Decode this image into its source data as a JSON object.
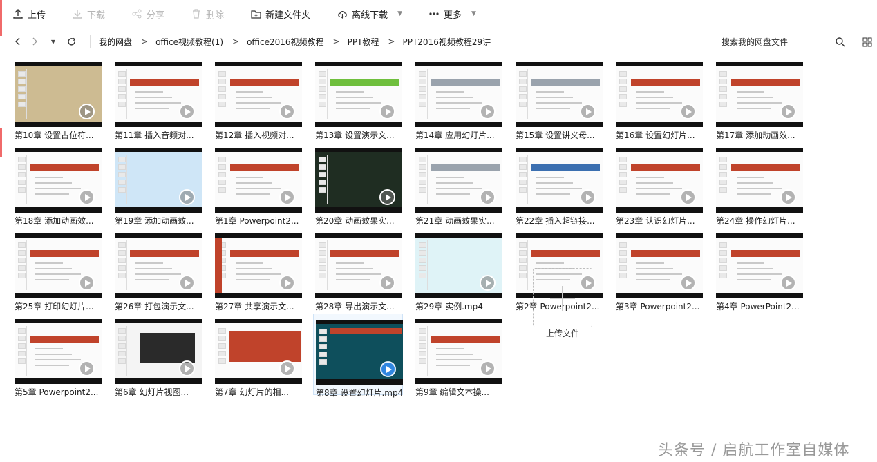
{
  "toolbar": {
    "upload": "上传",
    "download": "下载",
    "share": "分享",
    "delete": "删除",
    "new_folder": "新建文件夹",
    "offline_download": "离线下载",
    "more": "更多"
  },
  "breadcrumb": [
    "我的网盘",
    "office视频教程(1)",
    "office2016视频教程",
    "PPT教程",
    "PPT2016视频教程29讲"
  ],
  "search": {
    "placeholder": "搜索我的网盘文件"
  },
  "files": [
    {
      "name": "第10章 设置占位符...",
      "style": "parchment"
    },
    {
      "name": "第11章 插入音频对...",
      "style": "red"
    },
    {
      "name": "第12章 插入视频对...",
      "style": "photo"
    },
    {
      "name": "第13章 设置演示文...",
      "style": "green"
    },
    {
      "name": "第14章 应用幻灯片...",
      "style": "dialog"
    },
    {
      "name": "第15章 设置讲义母...",
      "style": "gray"
    },
    {
      "name": "第16章 设置幻灯片...",
      "style": "red"
    },
    {
      "name": "第17章 添加动画效...",
      "style": "red"
    },
    {
      "name": "第18章 添加动画效...",
      "style": "red"
    },
    {
      "name": "第19章 添加动画效...",
      "style": "sky"
    },
    {
      "name": "第1章 Powerpoint2...",
      "style": "red"
    },
    {
      "name": "第20章 动画效果实...",
      "style": "dark-green"
    },
    {
      "name": "第21章 动画效果实...",
      "style": "colors"
    },
    {
      "name": "第22章 插入超链接...",
      "style": "blue-text"
    },
    {
      "name": "第23章 认识幻灯片...",
      "style": "red"
    },
    {
      "name": "第24章 操作幻灯片...",
      "style": "red"
    },
    {
      "name": "第25章 打印幻灯片...",
      "style": "red"
    },
    {
      "name": "第26章 打包演示文...",
      "style": "red"
    },
    {
      "name": "第27章 共享演示文...",
      "style": "red-side"
    },
    {
      "name": "第28章 导出演示文...",
      "style": "red"
    },
    {
      "name": "第29章 实例.mp4",
      "style": "cyan"
    },
    {
      "name": "第2章 Powerpoint2...",
      "style": "red"
    },
    {
      "name": "第3章 Powerpoint2...",
      "style": "red"
    },
    {
      "name": "第4章 PowerPoint2...",
      "style": "red"
    },
    {
      "name": "第5章 Powerpoint2...",
      "style": "red"
    },
    {
      "name": "第6章 幻灯片视图...",
      "style": "black-slide"
    },
    {
      "name": "第7章 幻灯片的相...",
      "style": "red-full"
    },
    {
      "name": "第8章 设置幻灯片.mp4",
      "style": "teal",
      "selected": true
    },
    {
      "name": "第9章 编辑文本操...",
      "style": "red"
    }
  ],
  "upload_tile": {
    "label": "上传文件"
  },
  "watermark": "头条号 / 启航工作室自媒体",
  "colors": {
    "accent_red": "#c0432b",
    "selected_bg": "#f2f8fe",
    "play_active": "#2f86e0"
  }
}
